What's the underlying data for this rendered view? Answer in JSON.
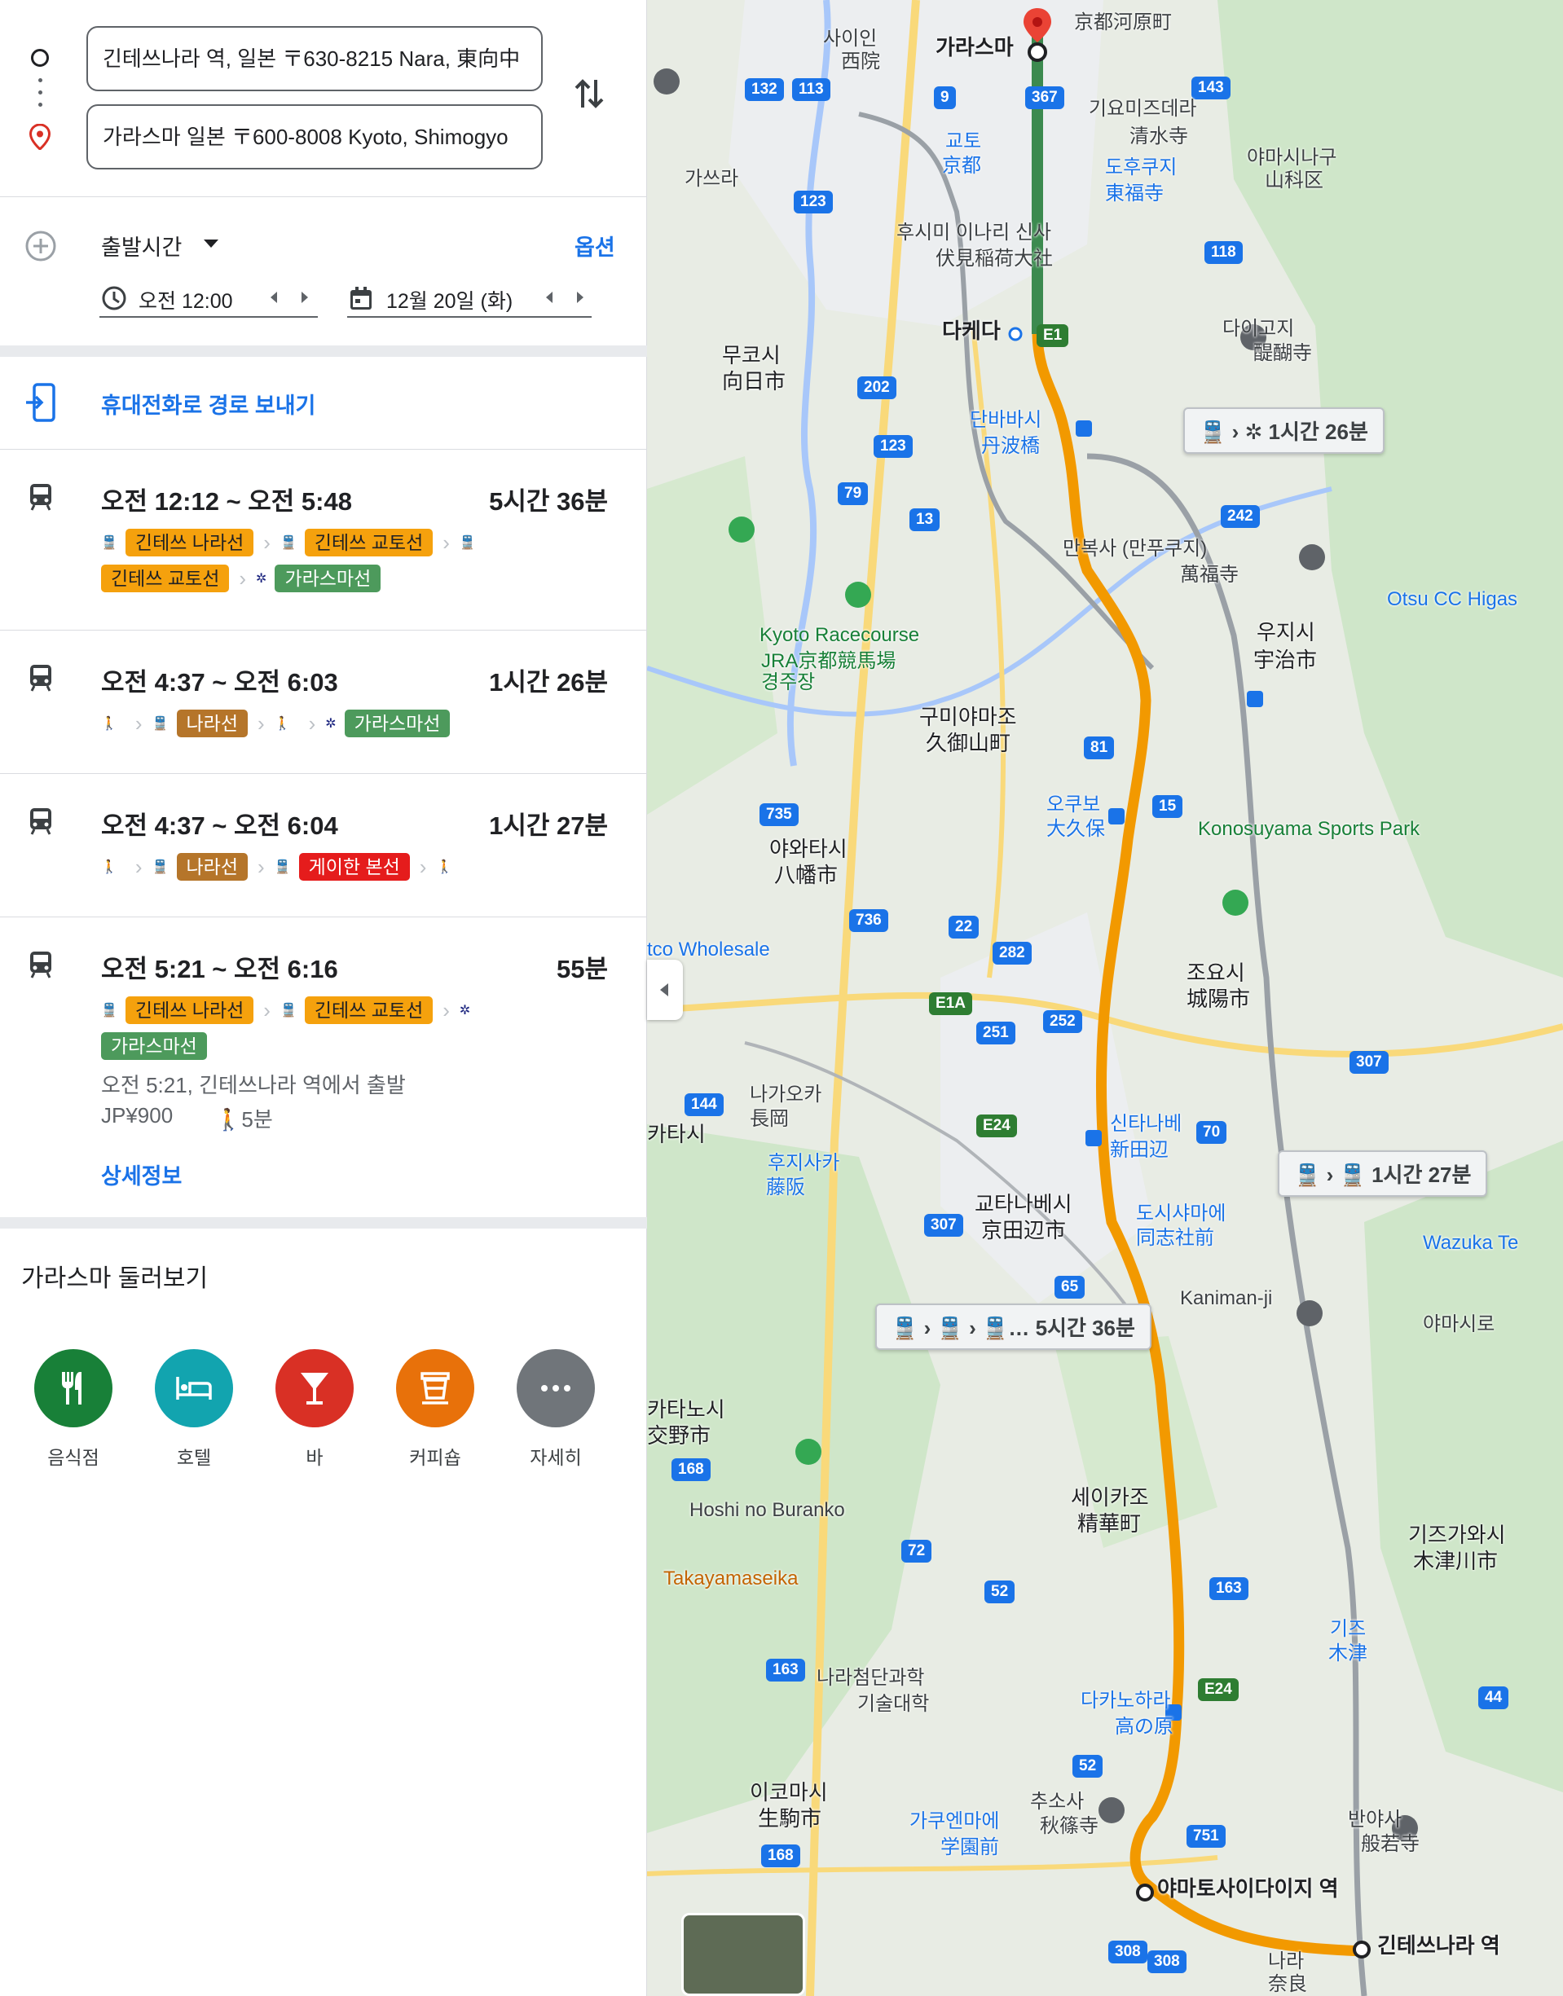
{
  "inputs": {
    "origin": "긴테쓰나라 역, 일본 〒630-8215 Nara, 東向中",
    "destination": "가라스마 일본 〒600-8008 Kyoto, Shimogyo"
  },
  "departure": {
    "mode_label": "출발시간",
    "options_label": "옵션",
    "time": "오전 12:00",
    "date": "12월 20일 (화)"
  },
  "send_to_phone": "휴대전화로 경로 보내기",
  "routes": [
    {
      "times": "오전 12:12 ~ 오전 5:48",
      "duration": "5시간 36분",
      "lines": [
        "긴테쓰 나라선",
        "긴테쓰 교토선",
        "긴테쓰 교토선",
        "가라스마선"
      ]
    },
    {
      "times": "오전 4:37 ~ 오전 6:03",
      "duration": "1시간 26분",
      "lines": [
        "나라선",
        "가라스마선"
      ]
    },
    {
      "times": "오전 4:37 ~ 오전 6:04",
      "duration": "1시간 27분",
      "lines": [
        "나라선",
        "게이한 본선"
      ]
    },
    {
      "times": "오전 5:21 ~ 오전 6:16",
      "duration": "55분",
      "lines": [
        "긴테쓰 나라선",
        "긴테쓰 교토선",
        "가라스마선"
      ],
      "detail": "오전 5:21, 긴테쓰나라 역에서 출발",
      "fare": "JP¥900",
      "walk": "5분",
      "details_link": "상세정보"
    }
  ],
  "explore": {
    "title": "가라스마 둘러보기",
    "categories": [
      {
        "label": "음식점",
        "color": "#188038",
        "icon": "restaurant-icon"
      },
      {
        "label": "호텔",
        "color": "#12a4af",
        "icon": "hotel-icon"
      },
      {
        "label": "바",
        "color": "#d93025",
        "icon": "bar-icon"
      },
      {
        "label": "커피숍",
        "color": "#e8710a",
        "icon": "coffee-icon"
      },
      {
        "label": "자세히",
        "color": "#70757a",
        "icon": "more-icon"
      }
    ]
  },
  "map": {
    "callouts": [
      "1시간 26분",
      "1시간 27분",
      "5시간 36분"
    ],
    "stations": {
      "dest": "가라스마",
      "takeda": "다케다",
      "yamato": "야마토사이다이지 역",
      "origin": "긴테쓰나라 역"
    },
    "labels": {
      "kiyomizu": "기요미즈데라",
      "kiyomizu_jp": "清水寺",
      "yamashina": "야마시나구",
      "yamashina_jp": "山科区",
      "tofukuji": "도후쿠지",
      "tofukuji_jp": "東福寺",
      "fushimi": "후시미 이나리 신사",
      "fushimi_jp": "伏見稲荷大社",
      "daigoji": "다이고지",
      "daigoji_jp": "醍醐寺",
      "muko": "무코시",
      "muko_jp": "向日市",
      "tambabashi": "단바바시",
      "tambabashi_jp": "丹波橋",
      "manpukuji": "만복사 (만푸쿠지)",
      "manpukuji_jp": "萬福寺",
      "uji": "우지시",
      "uji_jp": "宇治市",
      "kyoto_racecourse": "Kyoto Racecourse",
      "kyoto_racecourse_jp": "JRA京都競馬場",
      "kyoto_racecourse_kr": "경주장",
      "kumiyama": "구미야마조",
      "kumiyama_jp": "久御山町",
      "okubo": "오쿠보",
      "okubo_jp": "大久保",
      "yawata": "야와타시",
      "yawata_jp": "八幡市",
      "konosuyama": "Konosuyama Sports Park",
      "joyo": "조요시",
      "joyo_jp": "城陽市",
      "kyotanabe": "교타나베시",
      "kyotanabe_jp": "京田辺市",
      "shintanabe": "신타나베",
      "shintanabe_jp": "新田辺",
      "kaniman": "Kaniman-ji",
      "yamashiro": "야마시로",
      "seika": "세이카조",
      "seika_jp": "精華町",
      "kizugawa": "기즈가와시",
      "kizugawa_jp": "木津川市",
      "takanohara": "다카노하라",
      "takanohara_jp": "高の原",
      "ikoma": "이코마시",
      "ikoma_jp": "生駒市",
      "nara_univ": "나라첨단과학",
      "nara_univ2": "기술대학",
      "gakuenmae": "가쿠엔마에",
      "gakuenmae_jp": "学園前",
      "nara": "나라",
      "nara_jp": "奈良",
      "takayamaseika": "Takayamaseika",
      "hoshi": "Hoshi no Buranko",
      "wazuka": "Wazuka Te",
      "otsu": "Otsu CC Higas",
      "wholesale": "tco Wholesale",
      "hirakata": "카타시",
      "katano": "카타노시",
      "katano_jp": "交野市",
      "kyoto_stn": "교토",
      "kyoto_stn_jp": "京都",
      "katsura": "가쓰라",
      "saiin": "사이인",
      "saiin_jp": "西院",
      "nagaoka": "나가오카",
      "nagaoka_jp": "長岡",
      "fujisaka": "후지사카",
      "fujisaka_jp": "藤阪",
      "doshisha": "도시샤마에",
      "doshisha_jp": "同志社前",
      "kizu": "기즈",
      "kizu_jp": "木津",
      "banyaji": "반야사",
      "banyaji_jp": "般若寺",
      "shosuji": "추소사",
      "shosuji_jp": "秋篠寺",
      "kawaramachi": "京都河原町"
    }
  }
}
